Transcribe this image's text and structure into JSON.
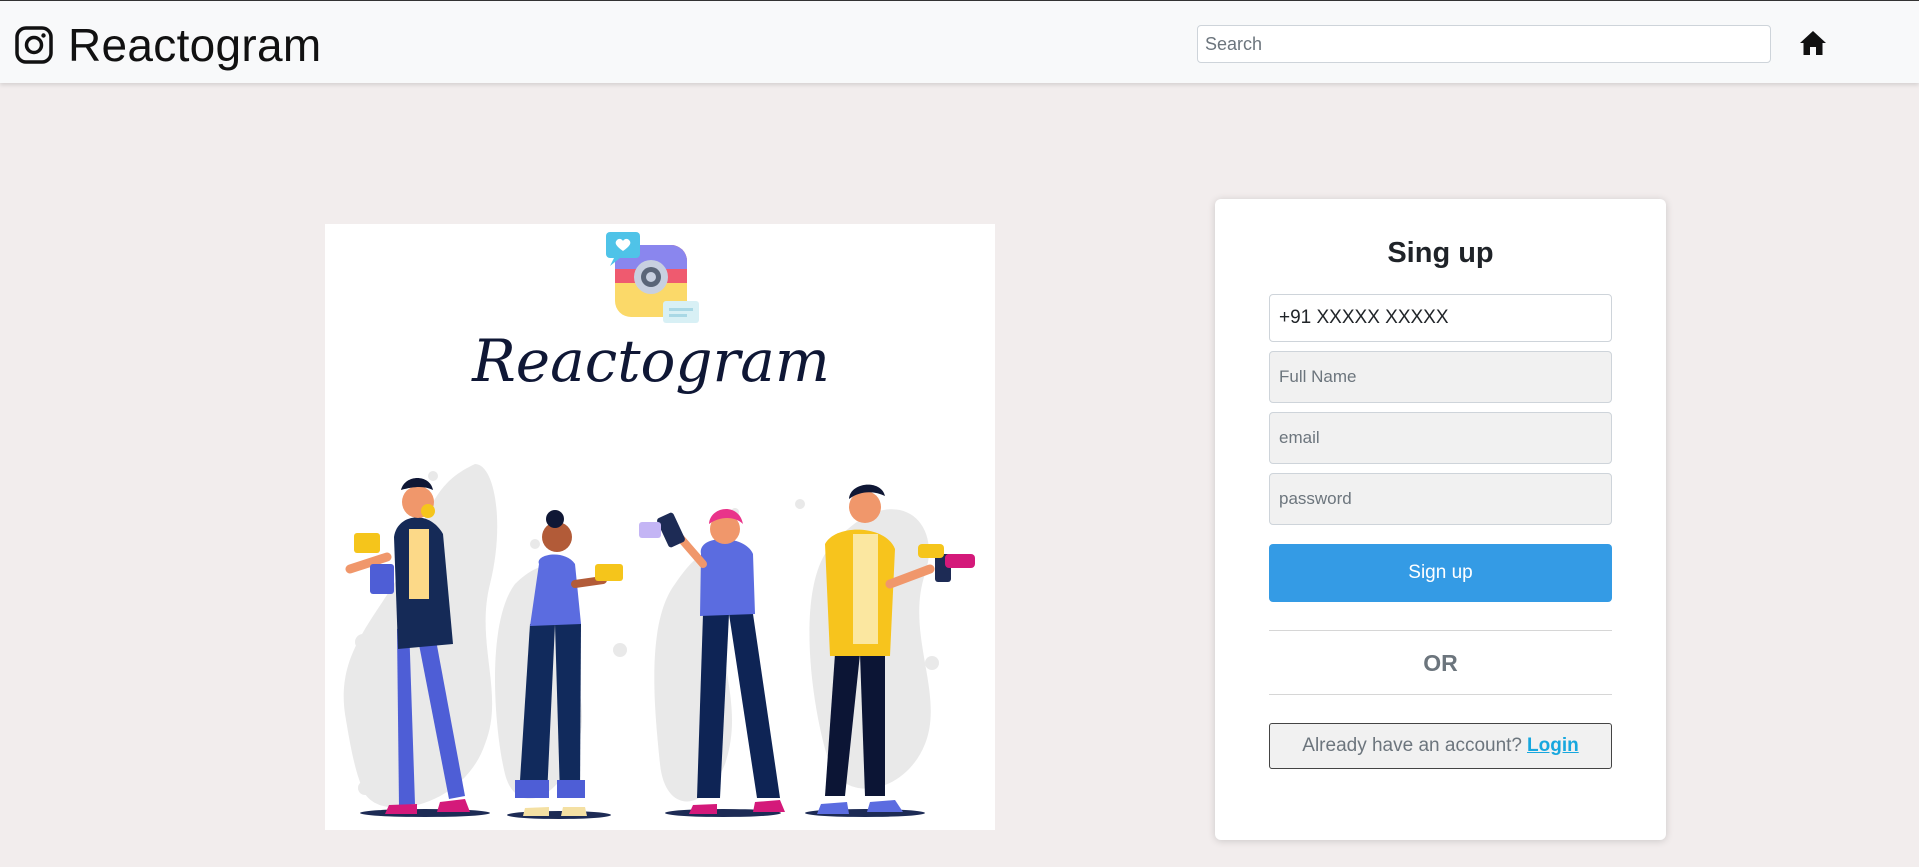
{
  "header": {
    "app_name": "Reactogram",
    "search_placeholder": "Search",
    "brand_icon": "instagram-icon",
    "home_icon": "home-icon"
  },
  "illustration": {
    "logo_text": "Reactogram",
    "icon": "camera-app-logo-icon"
  },
  "signup": {
    "title": "Sing up",
    "phone_value": "+91 XXXXX XXXXX",
    "fullname_placeholder": "Full Name",
    "email_placeholder": "email",
    "password_placeholder": "password",
    "button_label": "Sign up",
    "or_label": "OR",
    "login_prompt": "Already have an account?",
    "login_link": "Login"
  },
  "colors": {
    "page_background": "#f2eded",
    "primary_button": "#349be5",
    "login_link": "#17a7de"
  }
}
